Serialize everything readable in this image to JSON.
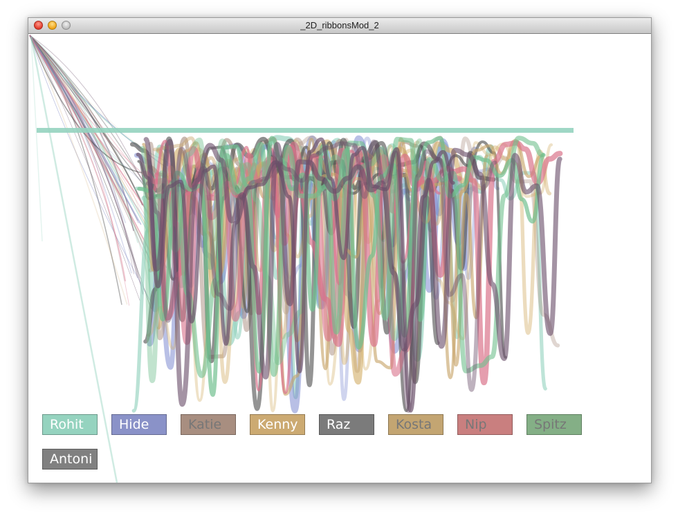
{
  "window": {
    "title": "_2D_ribbonsMod_2"
  },
  "legend": {
    "items": [
      {
        "label": "Rohit",
        "color": "#95d3bf",
        "text_dim": false
      },
      {
        "label": "Hide",
        "color": "#8a92c8",
        "text_dim": false
      },
      {
        "label": "Katie",
        "color": "#a88e80",
        "text_dim": true
      },
      {
        "label": "Kenny",
        "color": "#ccaa72",
        "text_dim": false
      },
      {
        "label": "Raz",
        "color": "#7b7b7b",
        "text_dim": false
      },
      {
        "label": "Kosta",
        "color": "#c3a572",
        "text_dim": true
      },
      {
        "label": "Nip",
        "color": "#c97f7f",
        "text_dim": true
      },
      {
        "label": "Spitz",
        "color": "#84af86",
        "text_dim": true
      },
      {
        "label": "Antoni",
        "color": "#808080",
        "text_dim": false
      }
    ]
  },
  "ribbons": [
    {
      "name": "Rohit",
      "color": "#95d3bf"
    },
    {
      "name": "Hide",
      "color": "#7d8bd0"
    },
    {
      "name": "Katie",
      "color": "#a88e80"
    },
    {
      "name": "Kenny",
      "color": "#d1ab62"
    },
    {
      "name": "Raz",
      "color": "#555555"
    },
    {
      "name": "Kosta",
      "color": "#c8a46a"
    },
    {
      "name": "Nip",
      "color": "#d9728a"
    },
    {
      "name": "Spitz",
      "color": "#6fbf8e"
    },
    {
      "name": "Antoni",
      "color": "#6a4f6a"
    }
  ]
}
